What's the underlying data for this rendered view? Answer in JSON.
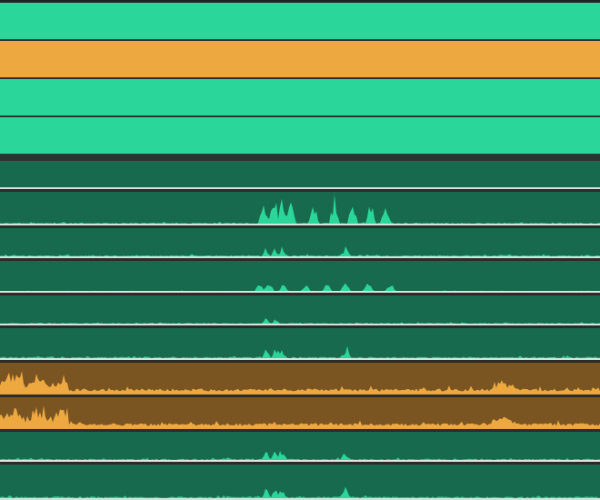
{
  "app": {
    "view": "multitrack-timeline"
  },
  "colors": {
    "background": "#2b2b2b",
    "top_border": "#202224",
    "divider": "#2f3231",
    "track_bright_green": "#2bd69b",
    "track_bright_orange": "#eda83f",
    "track_dark_green": "#176a4d",
    "track_dark_orange": "#7a5522",
    "wave_green": "#2bd69b",
    "wave_orange": "#eda83f",
    "lane_separator": "#e9ede9"
  },
  "header_tracks": [
    {
      "id": "clip-1",
      "color": "green",
      "selected": false
    },
    {
      "id": "clip-2",
      "color": "orange",
      "selected": true
    },
    {
      "id": "clip-3",
      "color": "green",
      "selected": false
    },
    {
      "id": "clip-4",
      "color": "green",
      "selected": false
    }
  ],
  "waveform_lanes": [
    {
      "id": "lane-1",
      "color": "green",
      "activity": "silent"
    },
    {
      "id": "lane-2",
      "color": "green",
      "activity": "medium-burst"
    },
    {
      "id": "lane-3",
      "color": "green",
      "activity": "low"
    },
    {
      "id": "lane-4",
      "color": "green",
      "activity": "low-burst"
    },
    {
      "id": "lane-5",
      "color": "green",
      "activity": "minimal"
    },
    {
      "id": "lane-6",
      "color": "green",
      "activity": "low"
    },
    {
      "id": "lane-7",
      "color": "orange",
      "activity": "high"
    },
    {
      "id": "lane-8",
      "color": "orange",
      "activity": "high"
    },
    {
      "id": "lane-9",
      "color": "green",
      "activity": "low"
    },
    {
      "id": "lane-10",
      "color": "green",
      "activity": "low"
    }
  ]
}
